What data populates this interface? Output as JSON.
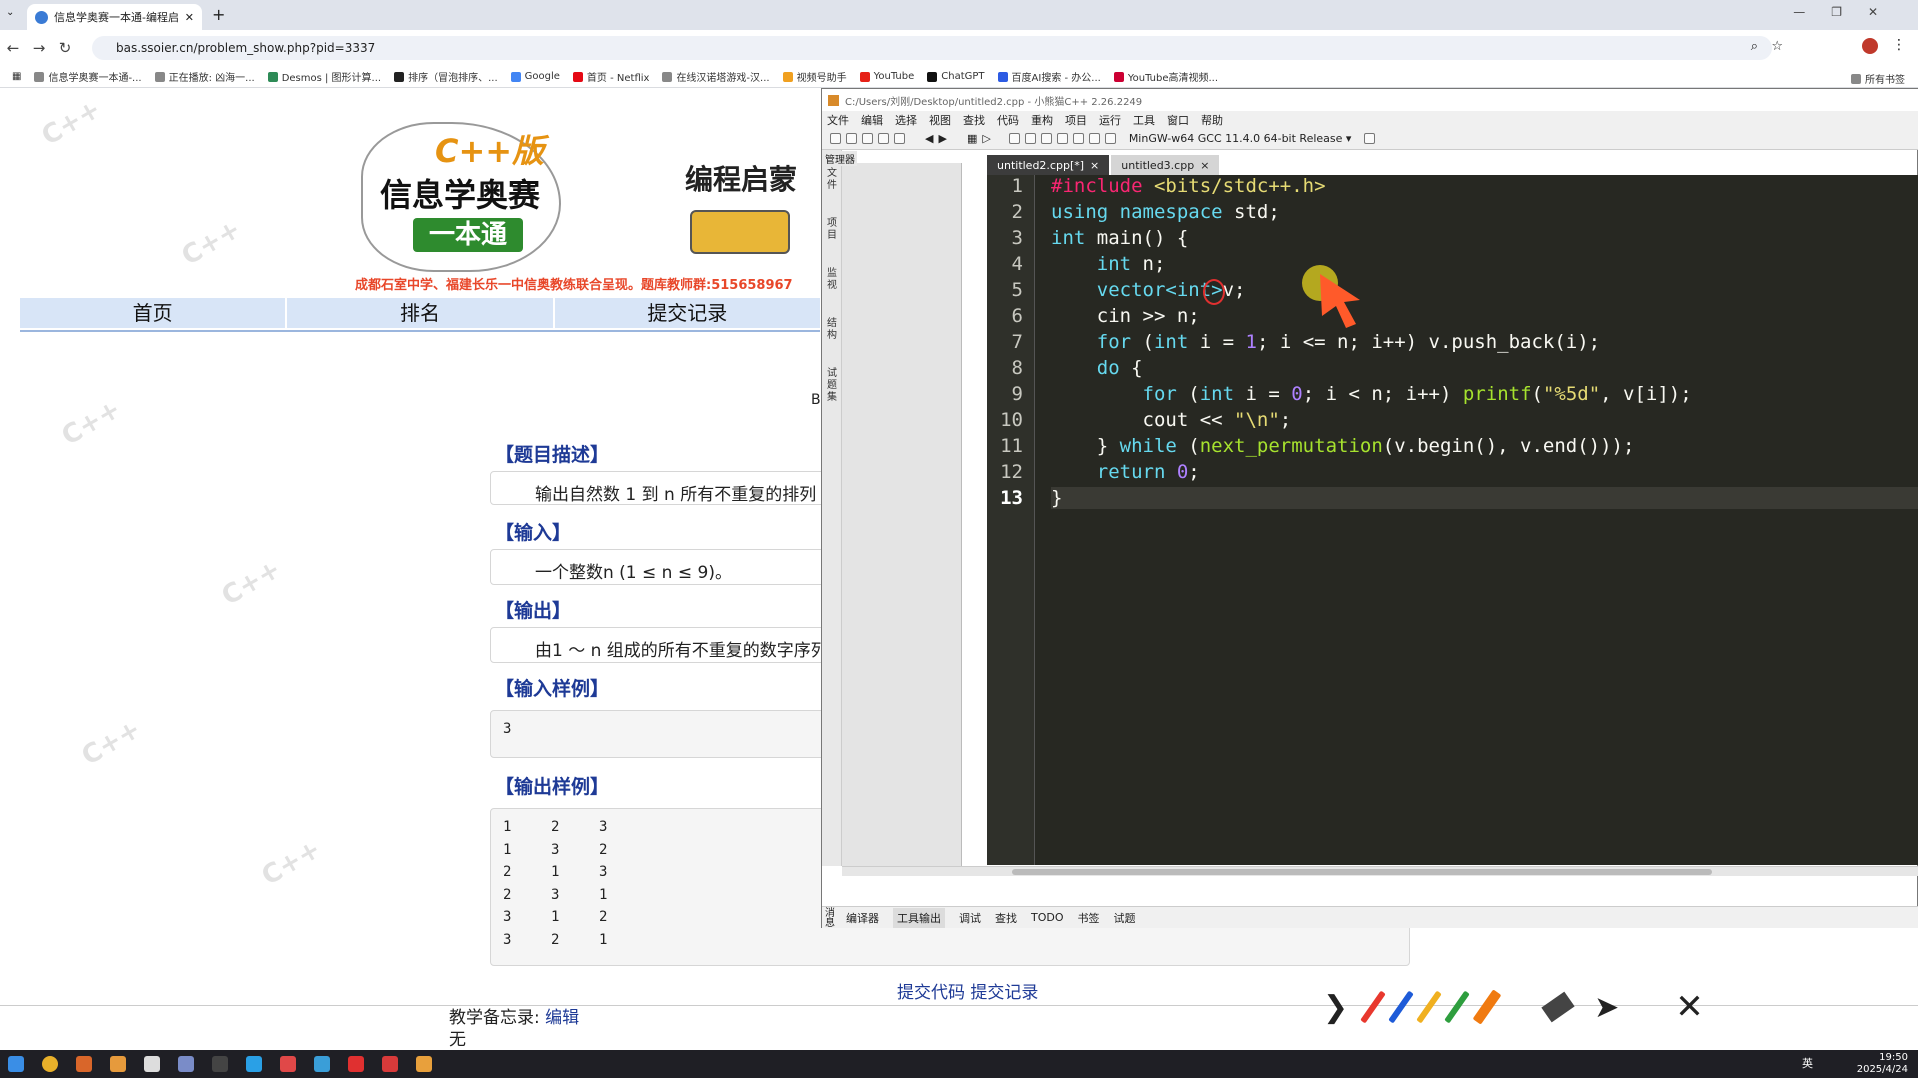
{
  "browser": {
    "tab_title": "信息学奥赛一本通-编程启蒙（C",
    "new_tab": "+",
    "url": "bas.ssoier.cn/problem_show.php?pid=3337",
    "bookmarks": [
      "信息学奥赛一本通-...",
      "正在播放: 凶海一...",
      "Desmos | 图形计算...",
      "排序（冒泡排序、...",
      "Google",
      "首页 - Netflix",
      "在线汉诺塔游戏-汉...",
      "视频号助手",
      "YouTube",
      "ChatGPT",
      "百度AI搜索 - 办公...",
      "YouTube高清视频..."
    ],
    "all_bookmarks": "所有书签"
  },
  "banner": {
    "cpp_label": "C++版",
    "title_main": "信息学奥赛",
    "title_badge": "一本通",
    "title_right": "编程启蒙",
    "red_line": "成都石室中学、福建长乐一中信奥教练联合呈现。题库教师群:515658967"
  },
  "nav": [
    "首页",
    "排名",
    "提交记录"
  ],
  "cut_text": "B",
  "problem": {
    "desc_h": "【题目描述】",
    "desc": "输出自然数 1 到 n 所有不重复的排列",
    "input_h": "【输入】",
    "input": "一个整数n (1 ≤ n ≤ 9)。",
    "output_h": "【输出】",
    "output": "由1 ～ n 组成的所有不重复的数字序列",
    "sample_in_h": "【输入样例】",
    "sample_in": "3",
    "sample_out_h": "【输出样例】",
    "sample_out": [
      [
        "1",
        "2",
        "3"
      ],
      [
        "1",
        "3",
        "2"
      ],
      [
        "2",
        "1",
        "3"
      ],
      [
        "2",
        "3",
        "1"
      ],
      [
        "3",
        "1",
        "2"
      ],
      [
        "3",
        "2",
        "1"
      ]
    ],
    "submit": "提交代码",
    "records": "提交记录",
    "memo_label": "教学备忘录:",
    "memo_edit": "编辑",
    "memo_text": "无"
  },
  "ide": {
    "title": "C:/Users/刘刚/Desktop/untitled2.cpp - 小熊猫C++ 2.26.2249",
    "menus": [
      "文件",
      "编辑",
      "选择",
      "视图",
      "查找",
      "代码",
      "重构",
      "项目",
      "运行",
      "工具",
      "窗口",
      "帮助"
    ],
    "compiler": "MinGW-w64 GCC 11.4.0 64-bit Release",
    "manager": "管理器",
    "side_tabs": [
      "文件",
      "项目",
      "监视",
      "结构",
      "试题集"
    ],
    "tabs": [
      "untitled2.cpp[*]",
      "untitled3.cpp"
    ],
    "tab_close": "×",
    "line_numbers": [
      "1",
      "2",
      "3",
      "4",
      "5",
      "6",
      "7",
      "8",
      "9",
      "10",
      "11",
      "12",
      "13"
    ],
    "code": {
      "l1a": "#include",
      "l1b": " <bits/stdc++.h>",
      "l2a": "using",
      "l2b": " namespace",
      "l2c": " std;",
      "l3a": "int",
      "l3b": " main() {",
      "l4a": "    int",
      "l4b": " n;",
      "l5a": "    vector<int>",
      "l5b": "v;",
      "l6": "    cin >> n;",
      "l7a": "    for",
      "l7b": " (",
      "l7c": "int",
      "l7d": " i = ",
      "l7e": "1",
      "l7f": "; i <= n; i++) v.push_back(i);",
      "l8a": "    do",
      "l8b": " {",
      "l9a": "        for",
      "l9b": " (",
      "l9c": "int",
      "l9d": " i = ",
      "l9e": "0",
      "l9f": "; i < n; i++) ",
      "l9g": "printf",
      "l9h": "(",
      "l9i": "\"%5d\"",
      "l9j": ", v[i]);",
      "l10a": "        cout << ",
      "l10b": "\"\\n\"",
      "l10c": ";",
      "l11a": "    } ",
      "l11b": "while",
      "l11c": " (",
      "l11d": "next_permutation",
      "l11e": "(v.begin(), v.end()));",
      "l12a": "    return",
      "l12b": " ",
      "l12c": "0",
      "l12d": ";",
      "l13": "}"
    },
    "bottom_tabs": [
      "编译器",
      "工具输出",
      "调试",
      "查找",
      "TODO",
      "书签",
      "试题"
    ],
    "bottom_side": "消息"
  },
  "tray": {
    "time": "19:50",
    "date": "2025/4/24",
    "lang": "英"
  },
  "colors": {
    "editor_bg": "#272822",
    "keyword": "#66d9ef",
    "string": "#e6db74",
    "number": "#ae81ff",
    "nav_bg": "#d8e5f7",
    "section": "#1e3a96"
  }
}
